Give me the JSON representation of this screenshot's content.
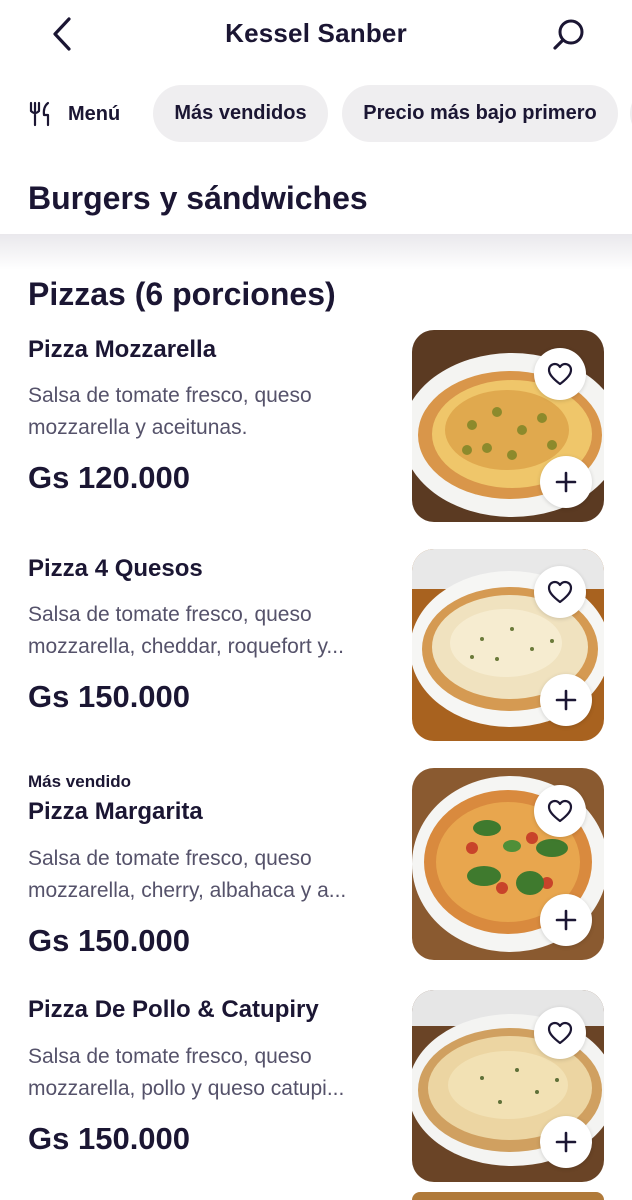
{
  "header": {
    "title": "Kessel Sanber",
    "back_icon": "chevron-left-icon",
    "search_icon": "search-icon"
  },
  "filters": {
    "menu_icon": "fork-knife-icon",
    "menu_label": "Menú",
    "chips": [
      "Más vendidos",
      "Precio más bajo primero"
    ]
  },
  "category": {
    "title": "Burgers y sándwiches"
  },
  "section": {
    "title": "Pizzas (6 porciones)"
  },
  "items": [
    {
      "badge": "",
      "name": "Pizza Mozzarella",
      "desc_line1": "Salsa de tomate fresco, queso",
      "desc_line2": "mozzarella y aceitunas.",
      "price": "Gs 120.000"
    },
    {
      "badge": "",
      "name": "Pizza 4 Quesos",
      "desc_line1": "Salsa de tomate fresco, queso",
      "desc_line2": "mozzarella, cheddar, roquefort y...",
      "price": "Gs 150.000"
    },
    {
      "badge": "Más vendido",
      "name": "Pizza Margarita",
      "desc_line1": "Salsa de tomate fresco, queso",
      "desc_line2": "mozzarella, cherry, albahaca y a...",
      "price": "Gs 150.000"
    },
    {
      "badge": "",
      "name": "Pizza De Pollo & Catupiry",
      "desc_line1": "Salsa de tomate fresco, queso",
      "desc_line2": "mozzarella, pollo y queso catupi...",
      "price": "Gs 150.000"
    }
  ],
  "colors": {
    "text": "#1b1633",
    "muted": "#55526a",
    "chip_bg": "#efeef0",
    "crust": "#d9964a",
    "cheese": "#efc66a"
  }
}
